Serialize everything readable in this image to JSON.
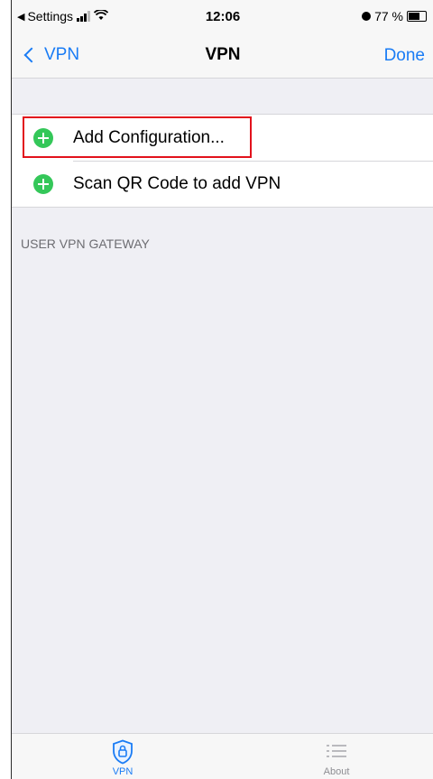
{
  "status_bar": {
    "back_app": "Settings",
    "time": "12:06",
    "battery_text": "77 %",
    "battery_level": 0.77
  },
  "nav": {
    "back_label": "VPN",
    "title": "VPN",
    "done_label": "Done"
  },
  "list": {
    "items": [
      {
        "label": "Add Configuration..."
      },
      {
        "label": "Scan QR Code to add VPN"
      }
    ]
  },
  "section": {
    "header": "USER VPN GATEWAY"
  },
  "tabs": [
    {
      "label": "VPN",
      "icon": "shield-lock-icon",
      "selected": true
    },
    {
      "label": "About",
      "icon": "list-icon",
      "selected": false
    }
  ],
  "colors": {
    "accent": "#1a7cf5",
    "add_icon": "#34c759",
    "highlight": "#e2121c"
  }
}
